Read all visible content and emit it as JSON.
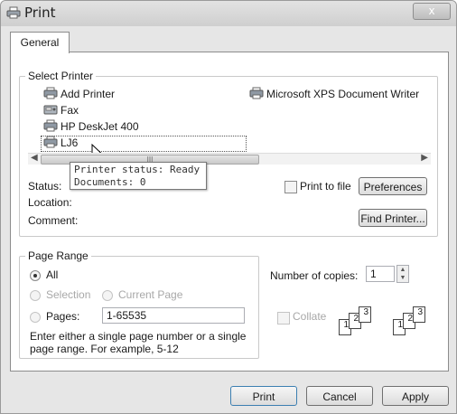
{
  "window": {
    "title": "Print",
    "close_label": "x"
  },
  "tabs": [
    {
      "label": "General"
    }
  ],
  "select_printer": {
    "group_label": "Select Printer",
    "printers": [
      {
        "label": "Add Printer",
        "icon": "add-printer-icon"
      },
      {
        "label": "Microsoft XPS Document Writer",
        "icon": "printer-icon"
      },
      {
        "label": "Fax",
        "icon": "fax-icon"
      },
      {
        "label": "HP DeskJet 400",
        "icon": "printer-icon"
      },
      {
        "label": "LJ6",
        "icon": "printer-icon",
        "selected": true
      }
    ],
    "scroll_thumb_label": "III",
    "tooltip": {
      "line1": "Printer status: Ready",
      "line2": "Documents: 0"
    },
    "status_label": "Status:",
    "location_label": "Location:",
    "comment_label": "Comment:",
    "print_to_file_label": "Print to file",
    "preferences_label": "Preferences",
    "find_printer_label": "Find Printer..."
  },
  "page_range": {
    "group_label": "Page Range",
    "all_label": "All",
    "selection_label": "Selection",
    "current_page_label": "Current Page",
    "pages_label": "Pages:",
    "pages_value": "1-65535",
    "hint_line1": "Enter either a single page number or a single",
    "hint_line2": "page range.  For example, 5-12"
  },
  "copies": {
    "label": "Number of copies:",
    "value": "1",
    "collate_label": "Collate",
    "page_numbers": [
      "1",
      "2",
      "3"
    ]
  },
  "footer": {
    "print_label": "Print",
    "cancel_label": "Cancel",
    "apply_label": "Apply"
  }
}
